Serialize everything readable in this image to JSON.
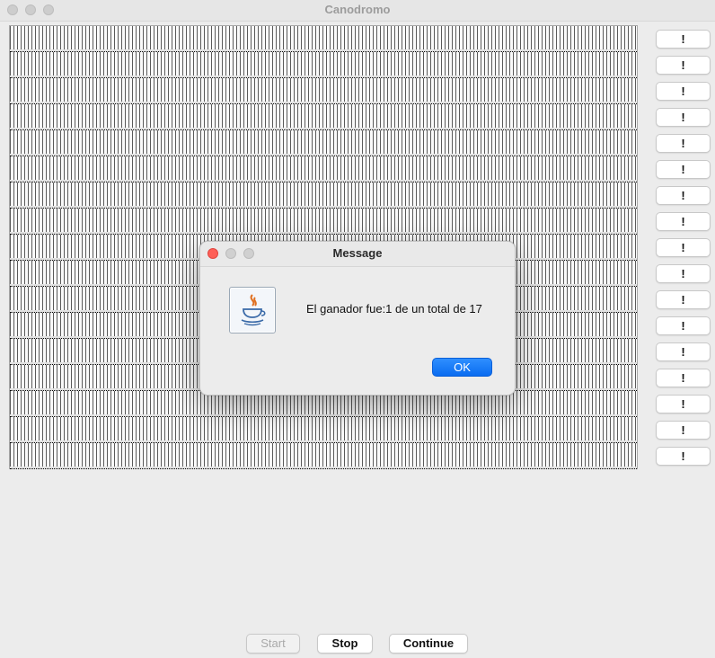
{
  "window": {
    "title": "Canodromo"
  },
  "lanes": {
    "count": 17,
    "button_label": "!"
  },
  "controls": {
    "start_label": "Start",
    "stop_label": "Stop",
    "continue_label": "Continue",
    "start_enabled": false
  },
  "dialog": {
    "title": "Message",
    "icon": "java-icon",
    "message": "El ganador fue:1 de un total de 17",
    "ok_label": "OK"
  }
}
